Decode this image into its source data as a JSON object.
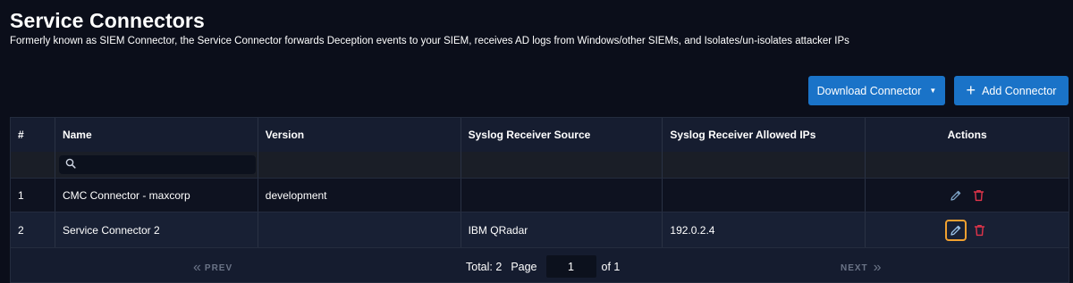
{
  "page": {
    "title": "Service Connectors",
    "subtitle": "Formerly known as SIEM Connector, the Service Connector forwards Deception events to your SIEM, receives AD logs from Windows/other SIEMs, and Isolates/un-isolates attacker IPs"
  },
  "toolbar": {
    "download_label": "Download Connector",
    "add_label": "Add Connector",
    "add_icon": "plus-icon",
    "download_icon": "caret-down-icon"
  },
  "table": {
    "columns": [
      "#",
      "Name",
      "Version",
      "Syslog Receiver Source",
      "Syslog Receiver Allowed IPs",
      "Actions"
    ],
    "filter": {
      "name_search_value": "",
      "search_icon": "search-icon"
    },
    "rows": [
      {
        "index": "1",
        "name": "CMC Connector - maxcorp",
        "version": "development",
        "source": "",
        "allowed_ips": ""
      },
      {
        "index": "2",
        "name": "Service Connector 2",
        "version": "",
        "source": "IBM QRadar",
        "allowed_ips": "192.0.2.4"
      }
    ]
  },
  "pagination": {
    "prev_label": "PREV",
    "next_label": "NEXT",
    "total_label": "Total: 2",
    "page_label": "Page",
    "page_value": "1",
    "of_label": "of 1"
  },
  "colors": {
    "accent": "#1a73c8",
    "edit_icon": "#7fa6c9",
    "delete_icon": "#e0344a",
    "focus_ring": "#f0a030"
  }
}
